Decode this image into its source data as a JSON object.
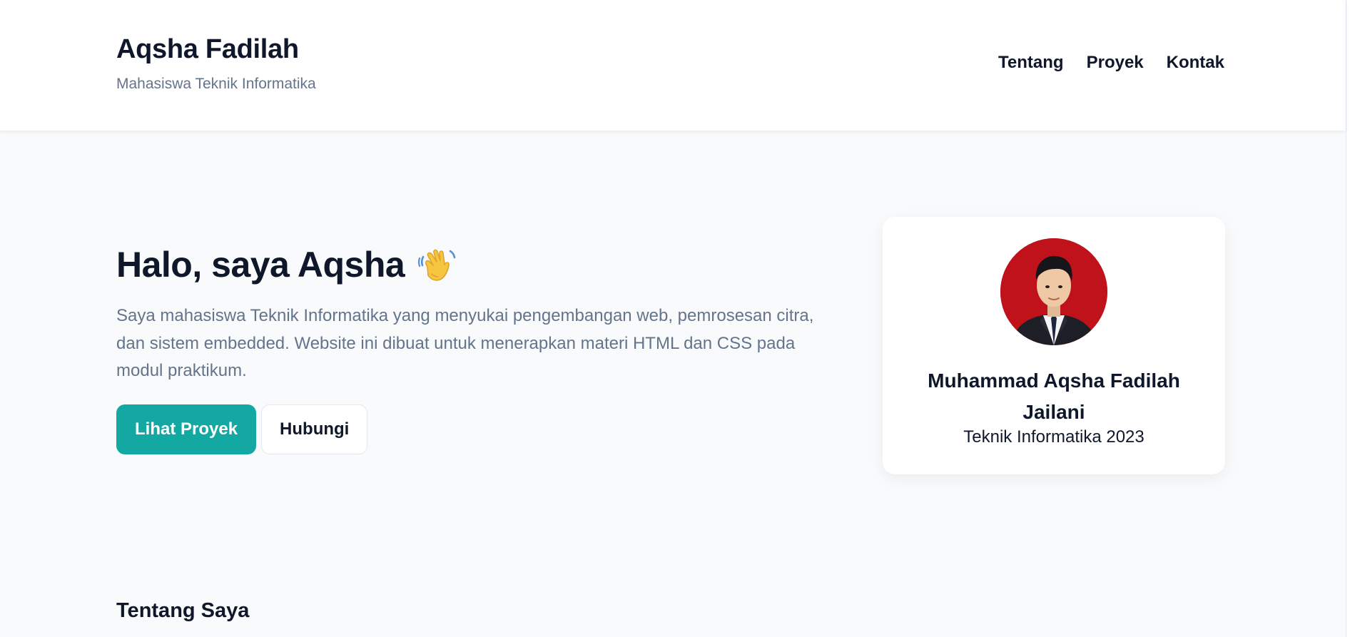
{
  "header": {
    "brand_name": "Aqsha Fadilah",
    "brand_subtitle": "Mahasiswa Teknik Informatika",
    "nav": [
      {
        "label": "Tentang"
      },
      {
        "label": "Proyek"
      },
      {
        "label": "Kontak"
      }
    ]
  },
  "hero": {
    "title": "Halo, saya Aqsha",
    "title_icon": "waving-hand-icon",
    "description": "Saya mahasiswa Teknik Informatika yang menyukai pengembangan web, pemrosesan citra, dan sistem embedded. Website ini dibuat untuk menerapkan materi HTML dan CSS pada modul praktikum.",
    "primary_button": "Lihat Proyek",
    "secondary_button": "Hubungi"
  },
  "profile": {
    "avatar_icon": "profile-photo",
    "name": "Muhammad Aqsha Fadilah Jailani",
    "role": "Teknik Informatika 2023"
  },
  "about": {
    "title": "Tentang Saya"
  },
  "colors": {
    "accent": "#14a8a3",
    "page_background": "#f8fafc",
    "heading": "#0f172a",
    "muted_text": "#64748b",
    "avatar_background": "#c0121a"
  }
}
